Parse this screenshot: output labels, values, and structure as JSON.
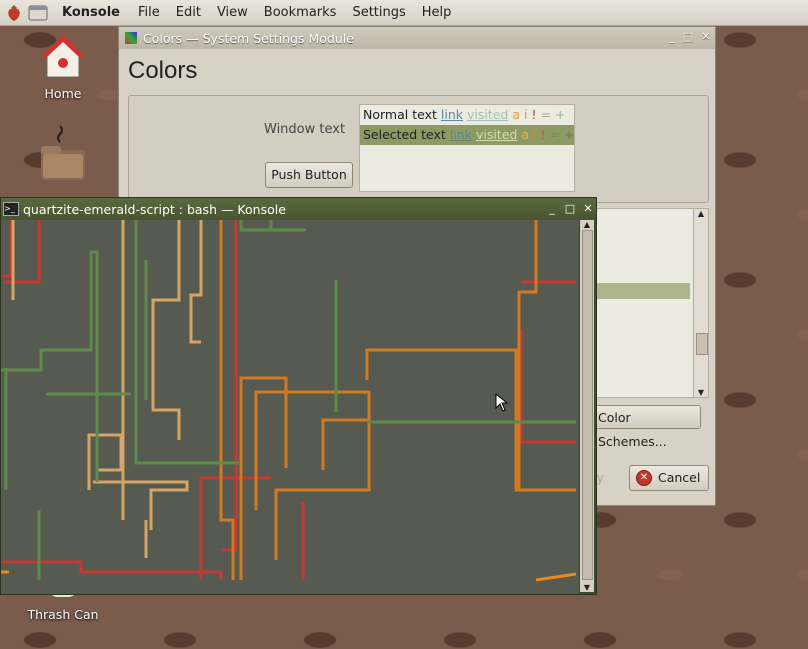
{
  "topbar": {
    "app_name": "Konsole",
    "menus": [
      "File",
      "Edit",
      "View",
      "Bookmarks",
      "Settings",
      "Help"
    ]
  },
  "desktop": {
    "icons": [
      {
        "label": "Home",
        "icon": "home-icon"
      },
      {
        "label": "",
        "icon": "folder-icon"
      },
      {
        "label": "Thrash Can",
        "icon": "trash-icon"
      }
    ]
  },
  "colors_window": {
    "title": "Colors — System Settings Module",
    "heading": "Colors",
    "window_text_label": "Window text",
    "push_button_label": "Push Button",
    "preview": {
      "normal_row": {
        "text": "Normal text",
        "link": "link",
        "visited": "visited",
        "a": "a",
        "i": "i",
        "bang": "!",
        "eq": "=",
        "plus": "+"
      },
      "selected_row": {
        "text": "Selected text",
        "link": "link",
        "visited": "visited",
        "a": "a",
        "i": "i",
        "bang": "!",
        "eq": "=",
        "plus": "+"
      }
    },
    "schemes_button_label": "Color Schemes...",
    "apply_label": "ly",
    "cancel_label": "Cancel"
  },
  "konsole": {
    "title": "quartzite-emerald-script : bash — Konsole"
  },
  "colors": {
    "accent": "#6b7d4a",
    "selection": "#8e9a63",
    "line_red": "#c43a30",
    "line_orange": "#d07a24",
    "line_tan": "#d6a565",
    "line_green": "#5e8a4a"
  }
}
